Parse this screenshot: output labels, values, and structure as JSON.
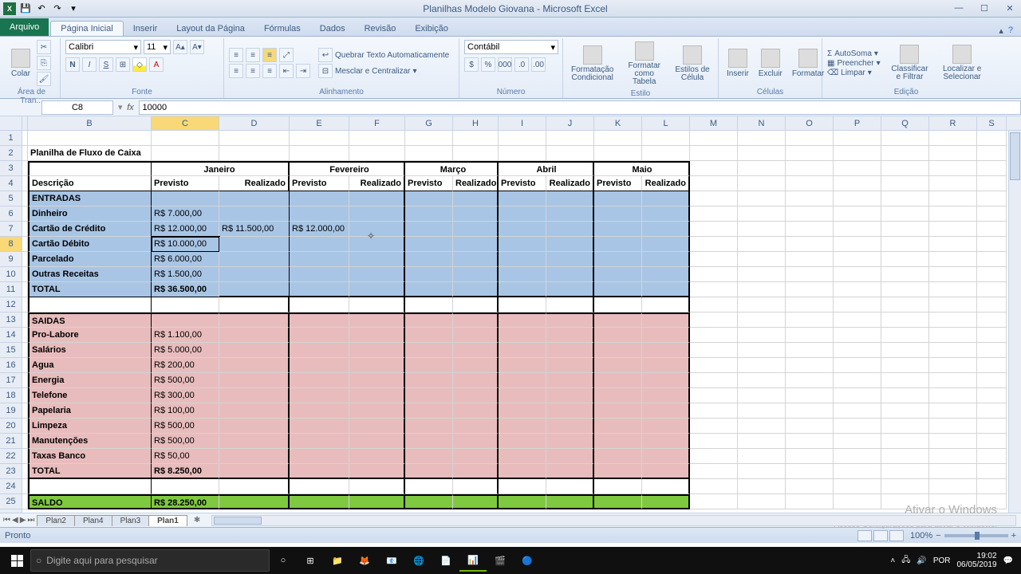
{
  "app": {
    "title": "Planilhas Modelo Giovana  -  Microsoft Excel"
  },
  "ribbon": {
    "file": "Arquivo",
    "tabs": [
      "Página Inicial",
      "Inserir",
      "Layout da Página",
      "Fórmulas",
      "Dados",
      "Revisão",
      "Exibição"
    ],
    "active_tab": 0,
    "groups": {
      "clipboard": {
        "label": "Área de Tran...",
        "paste": "Colar"
      },
      "font": {
        "label": "Fonte",
        "name": "Calibri",
        "size": "11"
      },
      "align": {
        "label": "Alinhamento",
        "wrap": "Quebrar Texto Automaticamente",
        "merge": "Mesclar e Centralizar"
      },
      "number": {
        "label": "Número",
        "format": "Contábil"
      },
      "styles": {
        "label": "Estilo",
        "cond": "Formatação Condicional",
        "table": "Formatar como Tabela",
        "cell": "Estilos de Célula"
      },
      "cells": {
        "label": "Células",
        "insert": "Inserir",
        "delete": "Excluir",
        "format": "Formatar"
      },
      "editing": {
        "label": "Edição",
        "sum": "AutoSoma",
        "fill": "Preencher",
        "clear": "Limpar",
        "sort": "Classificar e Filtrar",
        "find": "Localizar e Selecionar"
      }
    }
  },
  "namebox": "C8",
  "formula": "10000",
  "columns": [
    "A",
    "B",
    "C",
    "D",
    "E",
    "F",
    "G",
    "H",
    "I",
    "J",
    "K",
    "L",
    "M",
    "N",
    "O",
    "P",
    "Q",
    "R",
    "S"
  ],
  "rownums": [
    1,
    2,
    3,
    4,
    5,
    6,
    7,
    8,
    9,
    10,
    11,
    12,
    13,
    14,
    15,
    16,
    17,
    18,
    19,
    20,
    21,
    22,
    23,
    24,
    25
  ],
  "active": {
    "col": "C",
    "row": 8
  },
  "sheet": {
    "title": "Planilha de Fluxo de Caixa",
    "months": [
      "Janeiro",
      "Fevereiro",
      "Março",
      "Abril",
      "Maio"
    ],
    "sub": {
      "desc": "Descrição",
      "prev": "Previsto",
      "real": "Realizado"
    },
    "entradas_hdr": "ENTRADAS",
    "entradas": [
      {
        "label": "Dinheiro",
        "c": "R$    7.000,00"
      },
      {
        "label": "Cartão de Crédito",
        "c": "R$  12.000,00",
        "d": "R$  11.500,00",
        "e": "R$  12.000,00"
      },
      {
        "label": "Cartão Débito",
        "c": "R$  10.000,00"
      },
      {
        "label": "Parcelado",
        "c": "R$    6.000,00"
      },
      {
        "label": "Outras Receitas",
        "c": "R$    1.500,00"
      }
    ],
    "total_ent": {
      "label": "TOTAL",
      "c": "R$  36.500,00"
    },
    "saidas_hdr": "SAIDAS",
    "saidas": [
      {
        "label": "Pro-Labore",
        "c": "R$    1.100,00"
      },
      {
        "label": "Salários",
        "c": "R$    5.000,00"
      },
      {
        "label": "Agua",
        "c": "R$       200,00"
      },
      {
        "label": "Energia",
        "c": "R$       500,00"
      },
      {
        "label": "Telefone",
        "c": "R$       300,00"
      },
      {
        "label": "Papelaria",
        "c": "R$       100,00"
      },
      {
        "label": "Limpeza",
        "c": "R$       500,00"
      },
      {
        "label": "Manutenções",
        "c": "R$       500,00"
      },
      {
        "label": "Taxas Banco",
        "c": "R$         50,00"
      }
    ],
    "total_sai": {
      "label": "TOTAL",
      "c": "R$    8.250,00"
    },
    "saldo": {
      "label": "SALDO",
      "c": "R$  28.250,00"
    }
  },
  "tabs_bottom": [
    "Plan2",
    "Plan4",
    "Plan3",
    "Plan1"
  ],
  "tabs_active": 3,
  "status": {
    "ready": "Pronto",
    "zoom": "100%"
  },
  "watermark": {
    "t1": "Ativar o Windows",
    "t2": "Acesse Configurações para ativar o Windows."
  },
  "taskbar": {
    "search": "Digite aqui para pesquisar",
    "time": "19:02",
    "date": "06/05/2019"
  },
  "chart_data": {
    "type": "table",
    "title": "Planilha de Fluxo de Caixa",
    "months": [
      "Janeiro",
      "Fevereiro",
      "Março",
      "Abril",
      "Maio"
    ],
    "columns_per_month": [
      "Previsto",
      "Realizado"
    ],
    "entradas": {
      "Dinheiro": {
        "Janeiro_Previsto": 7000
      },
      "Cartão de Crédito": {
        "Janeiro_Previsto": 12000,
        "Janeiro_Realizado": 11500,
        "Fevereiro_Previsto": 12000
      },
      "Cartão Débito": {
        "Janeiro_Previsto": 10000
      },
      "Parcelado": {
        "Janeiro_Previsto": 6000
      },
      "Outras Receitas": {
        "Janeiro_Previsto": 1500
      },
      "TOTAL": {
        "Janeiro_Previsto": 36500
      }
    },
    "saidas": {
      "Pro-Labore": {
        "Janeiro_Previsto": 1100
      },
      "Salários": {
        "Janeiro_Previsto": 5000
      },
      "Agua": {
        "Janeiro_Previsto": 200
      },
      "Energia": {
        "Janeiro_Previsto": 500
      },
      "Telefone": {
        "Janeiro_Previsto": 300
      },
      "Papelaria": {
        "Janeiro_Previsto": 100
      },
      "Limpeza": {
        "Janeiro_Previsto": 500
      },
      "Manutenções": {
        "Janeiro_Previsto": 500
      },
      "Taxas Banco": {
        "Janeiro_Previsto": 50
      },
      "TOTAL": {
        "Janeiro_Previsto": 8250
      }
    },
    "saldo": {
      "Janeiro_Previsto": 28250
    }
  }
}
